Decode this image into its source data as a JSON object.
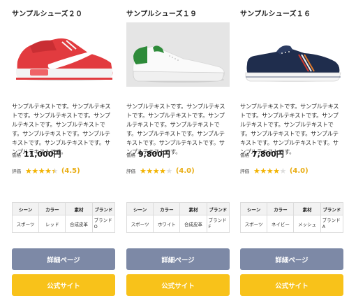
{
  "colors": {
    "detail_button": "#7d89a6",
    "official_button": "#f8c21a",
    "star": "#f4b400",
    "score": "#e9ad14"
  },
  "labels": {
    "price": "価格",
    "rating": "評価"
  },
  "spec_headers": [
    "シーン",
    "カラー",
    "素材",
    "ブランド"
  ],
  "products": [
    {
      "title": "サンプルシューズ２０",
      "image_icon": "red-sneaker-image",
      "description": "サンプルテキストです。サンプルテキストです。サンプルテキストです。サンプルテキストです。サンプルテキストです。サンプルテキストです。サンプルテキストです。サンプルテキストです。サンプルテキストです。",
      "price": "11,000円",
      "rating": 4.5,
      "rating_text": "(4.5)",
      "stars": "★★★★★",
      "specs": [
        "スポーツ",
        "レッド",
        "合成皮革",
        "ブランドO"
      ],
      "detail_label": "詳細ページ",
      "official_label": "公式サイト"
    },
    {
      "title": "サンプルシューズ１９",
      "image_icon": "white-green-sneaker-image",
      "description": "サンプルテキストです。サンプルテキストです。サンプルテキストです。サンプルテキストです。サンプルテキストです。サンプルテキストです。サンプルテキストです。サンプルテキストです。サンプルテキストです。",
      "price": "9,800円",
      "rating": 4.0,
      "rating_text": "(4.0)",
      "stars": "★★★★★",
      "specs": [
        "スポーツ",
        "ホワイト",
        "合成皮革",
        "ブランドF"
      ],
      "detail_label": "詳細ページ",
      "official_label": "公式サイト"
    },
    {
      "title": "サンプルシューズ１６",
      "image_icon": "navy-sneaker-image",
      "description": "サンプルテキストです。サンプルテキストです。サンプルテキストです。サンプルテキストです。サンプルテキストです。サンプルテキストです。サンプルテキストです。サンプルテキストです。サンプルテキストです。",
      "price": "7,800円",
      "rating": 4.0,
      "rating_text": "(4.0)",
      "stars": "★★★★★",
      "specs": [
        "スポーツ",
        "ネイビー",
        "メッシュ",
        "ブランドA"
      ],
      "detail_label": "詳細ページ",
      "official_label": "公式サイト"
    }
  ]
}
